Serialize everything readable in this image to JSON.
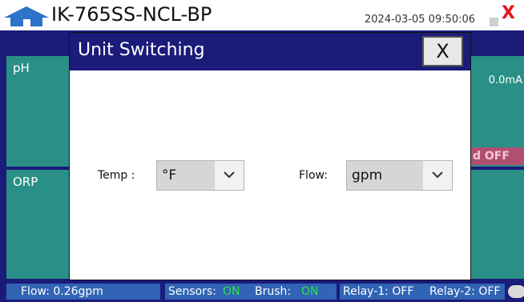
{
  "header": {
    "title": "IK-765SS-NCL-BP",
    "datetime": "2024-03-05 09:50:06",
    "close_label": "X"
  },
  "panels": {
    "ph": {
      "label": "pH"
    },
    "orp": {
      "label": "ORP"
    },
    "right_value": "0.0mA",
    "status_pill": "d OFF"
  },
  "dialog": {
    "title": "Unit Switching",
    "close_label": "X",
    "temp": {
      "label": "Temp :",
      "value": "°F"
    },
    "flow": {
      "label": "Flow:",
      "value": "gpm"
    }
  },
  "statusbar": {
    "flow": "Flow:  0.26gpm",
    "sensors_label": "Sensors:",
    "sensors_value": "ON",
    "brush_label": "Brush:",
    "brush_value": "ON",
    "relay1": "Relay-1: OFF",
    "relay2": "Relay-2: OFF"
  },
  "colors": {
    "navy": "#1b1b7a",
    "teal": "#2a8f86",
    "status_blue": "#3164b4",
    "on_green": "#2ee24a",
    "close_red": "#e8131a"
  }
}
